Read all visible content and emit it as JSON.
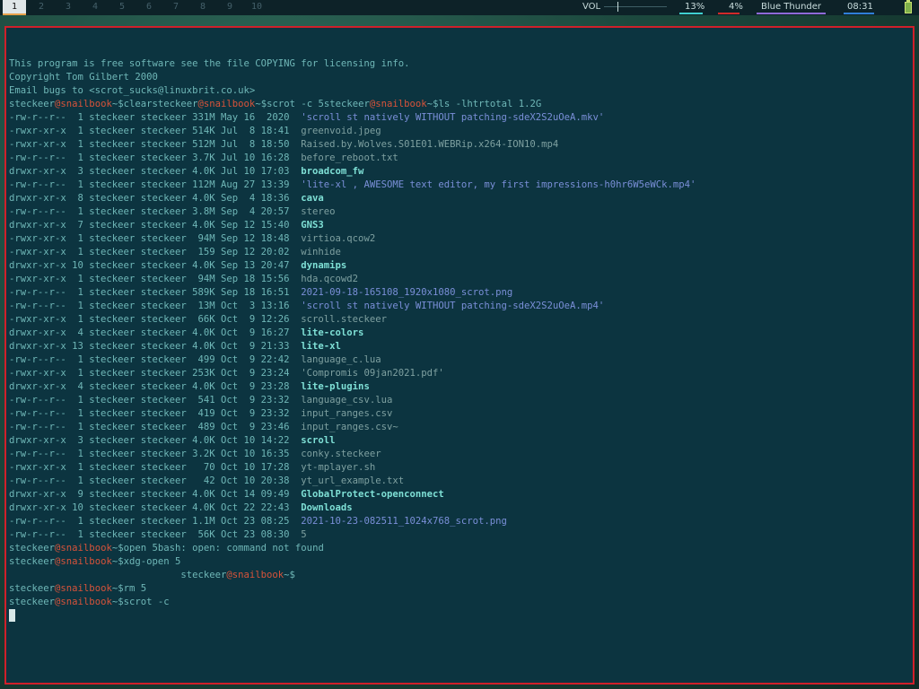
{
  "topbar": {
    "workspaces": [
      "1",
      "2",
      "3",
      "4",
      "5",
      "6",
      "7",
      "8",
      "9",
      "10"
    ],
    "active_workspace": "1",
    "vol_label": "VOL",
    "cpu": "13%",
    "mem": "4%",
    "theme": "Blue Thunder",
    "clock": "08:31"
  },
  "terminal": {
    "header": [
      "This program is free software see the file COPYING for licensing info.",
      "Copyright Tom Gilbert 2000",
      "Email bugs to <scrot_sucks@linuxbrit.co.uk>"
    ],
    "user": "steckeer",
    "host": "snailbook",
    "line1_cmd_a": "~$clear",
    "line1_cmd_b": "~$scrot -c 5",
    "line1_cmd_c": "~$ls -lhtr",
    "total": "total 1.2G",
    "listing": [
      {
        "m": "-rw-r--r-- ",
        "n": " 1",
        "s": "331M",
        "d": "May 16  2020",
        "name": "'scroll st natively WITHOUT patching-sdeX2S2uOeA.mkv'",
        "t": "link"
      },
      {
        "m": "-rwxr-xr-x ",
        "n": " 1",
        "s": "514K",
        "d": "Jul  8 18:41",
        "name": "greenvoid.jpeg",
        "t": "file"
      },
      {
        "m": "-rwxr-xr-x ",
        "n": " 1",
        "s": "512M",
        "d": "Jul  8 18:50",
        "name": "Raised.by.Wolves.S01E01.WEBRip.x264-ION10.mp4",
        "t": "file"
      },
      {
        "m": "-rw-r--r-- ",
        "n": " 1",
        "s": "3.7K",
        "d": "Jul 10 16:28",
        "name": "before_reboot.txt",
        "t": "file"
      },
      {
        "m": "drwxr-xr-x ",
        "n": " 3",
        "s": "4.0K",
        "d": "Jul 10 17:03",
        "name": "broadcom_fw",
        "t": "dir"
      },
      {
        "m": "-rw-r--r-- ",
        "n": " 1",
        "s": "112M",
        "d": "Aug 27 13:39",
        "name": "'lite-xl , AWESOME text editor, my first impressions-h0hr6W5eWCk.mp4'",
        "t": "link"
      },
      {
        "m": "drwxr-xr-x ",
        "n": " 8",
        "s": "4.0K",
        "d": "Sep  4 18:36",
        "name": "cava",
        "t": "dir"
      },
      {
        "m": "-rw-r--r-- ",
        "n": " 1",
        "s": "3.8M",
        "d": "Sep  4 20:57",
        "name": "stereo",
        "t": "file"
      },
      {
        "m": "drwxr-xr-x ",
        "n": " 7",
        "s": "4.0K",
        "d": "Sep 12 15:40",
        "name": "GNS3",
        "t": "dir"
      },
      {
        "m": "-rwxr-xr-x ",
        "n": " 1",
        "s": " 94M",
        "d": "Sep 12 18:48",
        "name": "virtioa.qcow2",
        "t": "file"
      },
      {
        "m": "-rwxr-xr-x ",
        "n": " 1",
        "s": " 159",
        "d": "Sep 12 20:02",
        "name": "winhide",
        "t": "file"
      },
      {
        "m": "drwxr-xr-x ",
        "n": "10",
        "s": "4.0K",
        "d": "Sep 13 20:47",
        "name": "dynamips",
        "t": "dir"
      },
      {
        "m": "-rwxr-xr-x ",
        "n": " 1",
        "s": " 94M",
        "d": "Sep 18 15:56",
        "name": "hda.qcowd2",
        "t": "file"
      },
      {
        "m": "-rw-r--r-- ",
        "n": " 1",
        "s": "589K",
        "d": "Sep 18 16:51",
        "name": "2021-09-18-165108_1920x1080_scrot.png",
        "t": "link"
      },
      {
        "m": "-rw-r--r-- ",
        "n": " 1",
        "s": " 13M",
        "d": "Oct  3 13:16",
        "name": "'scroll st natively WITHOUT patching-sdeX2S2uOeA.mp4'",
        "t": "link"
      },
      {
        "m": "-rwxr-xr-x ",
        "n": " 1",
        "s": " 66K",
        "d": "Oct  9 12:26",
        "name": "scroll.steckeer",
        "t": "file"
      },
      {
        "m": "drwxr-xr-x ",
        "n": " 4",
        "s": "4.0K",
        "d": "Oct  9 16:27",
        "name": "lite-colors",
        "t": "dir"
      },
      {
        "m": "drwxr-xr-x ",
        "n": "13",
        "s": "4.0K",
        "d": "Oct  9 21:33",
        "name": "lite-xl",
        "t": "dir"
      },
      {
        "m": "-rw-r--r-- ",
        "n": " 1",
        "s": " 499",
        "d": "Oct  9 22:42",
        "name": "language_c.lua",
        "t": "file"
      },
      {
        "m": "-rwxr-xr-x ",
        "n": " 1",
        "s": "253K",
        "d": "Oct  9 23:24",
        "name": "'Compromis 09jan2021.pdf'",
        "t": "file"
      },
      {
        "m": "drwxr-xr-x ",
        "n": " 4",
        "s": "4.0K",
        "d": "Oct  9 23:28",
        "name": "lite-plugins",
        "t": "dir"
      },
      {
        "m": "-rw-r--r-- ",
        "n": " 1",
        "s": " 541",
        "d": "Oct  9 23:32",
        "name": "language_csv.lua",
        "t": "file"
      },
      {
        "m": "-rw-r--r-- ",
        "n": " 1",
        "s": " 419",
        "d": "Oct  9 23:32",
        "name": "input_ranges.csv",
        "t": "file"
      },
      {
        "m": "-rw-r--r-- ",
        "n": " 1",
        "s": " 489",
        "d": "Oct  9 23:46",
        "name": "input_ranges.csv~",
        "t": "file"
      },
      {
        "m": "drwxr-xr-x ",
        "n": " 3",
        "s": "4.0K",
        "d": "Oct 10 14:22",
        "name": "scroll",
        "t": "dir"
      },
      {
        "m": "-rw-r--r-- ",
        "n": " 1",
        "s": "3.2K",
        "d": "Oct 10 16:35",
        "name": "conky.steckeer",
        "t": "file"
      },
      {
        "m": "-rwxr-xr-x ",
        "n": " 1",
        "s": "  70",
        "d": "Oct 10 17:28",
        "name": "yt-mplayer.sh",
        "t": "file"
      },
      {
        "m": "-rw-r--r-- ",
        "n": " 1",
        "s": "  42",
        "d": "Oct 10 20:38",
        "name": "yt_url_example.txt",
        "t": "file"
      },
      {
        "m": "drwxr-xr-x ",
        "n": " 9",
        "s": "4.0K",
        "d": "Oct 14 09:49",
        "name": "GlobalProtect-openconnect",
        "t": "dir"
      },
      {
        "m": "drwxr-xr-x ",
        "n": "10",
        "s": "4.0K",
        "d": "Oct 22 22:43",
        "name": "Downloads",
        "t": "dir"
      },
      {
        "m": "-rw-r--r-- ",
        "n": " 1",
        "s": "1.1M",
        "d": "Oct 23 08:25",
        "name": "2021-10-23-082511_1024x768_scrot.png",
        "t": "link"
      },
      {
        "m": "-rw-r--r-- ",
        "n": " 1",
        "s": " 56K",
        "d": "Oct 23 08:30",
        "name": "5",
        "t": "file"
      }
    ],
    "open_cmd": "~$open 5",
    "open_err": "bash: open: command not found",
    "xdg_cmd": "~$xdg-open 5",
    "dangling_prompt": "~$",
    "rm_cmd": "~$rm 5",
    "scrot_cmd": "~$scrot -c"
  }
}
